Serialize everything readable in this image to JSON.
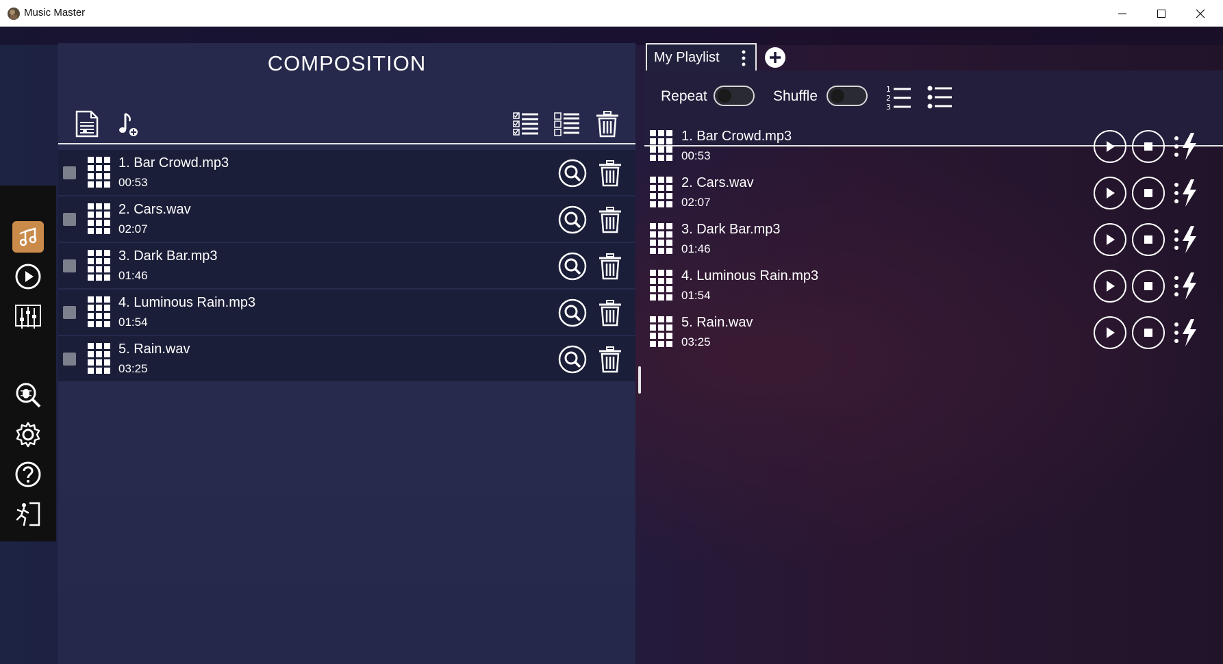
{
  "window": {
    "title": "Music Master",
    "controls": [
      "minimize-icon",
      "maximize-icon",
      "close-icon"
    ]
  },
  "sidebar": {
    "items": [
      {
        "name": "composition",
        "icon": "music-note-icon",
        "active": true
      },
      {
        "name": "player",
        "icon": "play-circle-icon",
        "active": false
      },
      {
        "name": "equalizer",
        "icon": "equalizer-icon",
        "active": false
      },
      {
        "name": "scan",
        "icon": "bug-search-icon",
        "active": false
      },
      {
        "name": "settings",
        "icon": "gear-icon",
        "active": false
      },
      {
        "name": "help",
        "icon": "help-icon",
        "active": false
      },
      {
        "name": "exit",
        "icon": "exit-icon",
        "active": false
      }
    ]
  },
  "composition": {
    "title": "COMPOSITION",
    "toolbar": [
      "new-file-icon",
      "add-music-icon",
      "select-all-list-icon",
      "deselect-list-icon",
      "delete-all-icon"
    ],
    "tracks": [
      {
        "name": "1. Bar Crowd.mp3",
        "duration": "00:53"
      },
      {
        "name": "2. Cars.wav",
        "duration": "02:07"
      },
      {
        "name": "3. Dark Bar.mp3",
        "duration": "01:46"
      },
      {
        "name": "4. Luminous Rain.mp3",
        "duration": "01:54"
      },
      {
        "name": "5. Rain.wav",
        "duration": "03:25"
      }
    ]
  },
  "playlist": {
    "tab_label": "My Playlist",
    "repeat_label": "Repeat",
    "shuffle_label": "Shuffle",
    "repeat_on": false,
    "shuffle_on": false,
    "tracks": [
      {
        "name": "1. Bar Crowd.mp3",
        "duration": "00:53"
      },
      {
        "name": "2. Cars.wav",
        "duration": "02:07"
      },
      {
        "name": "3. Dark Bar.mp3",
        "duration": "01:46"
      },
      {
        "name": "4. Luminous Rain.mp3",
        "duration": "01:54"
      },
      {
        "name": "5. Rain.wav",
        "duration": "03:25"
      }
    ]
  },
  "colors": {
    "accent": "#c98a4a",
    "panel": "#26294b",
    "row": "#1b1e38",
    "text": "#ffffff"
  }
}
